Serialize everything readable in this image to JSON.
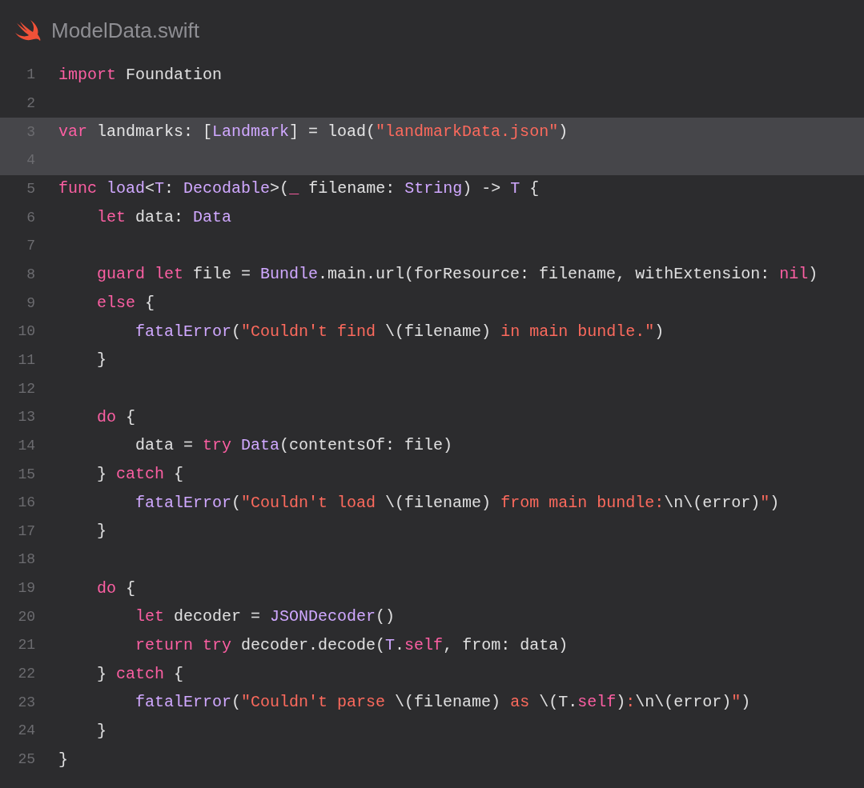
{
  "file_title": "ModelData.swift",
  "lines": [
    {
      "number": "1",
      "highlighted": false,
      "tokens": [
        {
          "kind": "keyword",
          "text": "import"
        },
        {
          "kind": "plain",
          "text": " Foundation"
        }
      ]
    },
    {
      "number": "2",
      "highlighted": false
    },
    {
      "number": "3",
      "highlighted": true,
      "tokens": [
        {
          "kind": "keyword",
          "text": "var"
        },
        {
          "kind": "plain",
          "text": " landmarks: ["
        },
        {
          "kind": "type",
          "text": "Landmark"
        },
        {
          "kind": "plain",
          "text": "] = load("
        },
        {
          "kind": "string",
          "text": "\"landmarkData.json\""
        },
        {
          "kind": "plain",
          "text": ")"
        }
      ]
    },
    {
      "number": "4",
      "highlighted": true
    },
    {
      "number": "5",
      "highlighted": false,
      "tokens": [
        {
          "kind": "keyword",
          "text": "func "
        },
        {
          "kind": "type",
          "text": "load"
        },
        {
          "kind": "plain",
          "text": "<"
        },
        {
          "kind": "type",
          "text": "T"
        },
        {
          "kind": "plain",
          "text": ": "
        },
        {
          "kind": "type",
          "text": "Decodable"
        },
        {
          "kind": "plain",
          "text": ">("
        },
        {
          "kind": "keyword",
          "text": "_"
        },
        {
          "kind": "plain",
          "text": " filename: "
        },
        {
          "kind": "type",
          "text": "String"
        },
        {
          "kind": "plain",
          "text": ") -> "
        },
        {
          "kind": "type",
          "text": "T"
        },
        {
          "kind": "plain",
          "text": " {"
        }
      ]
    },
    {
      "number": "6",
      "highlighted": false,
      "tokens": [
        {
          "kind": "keyword",
          "text": "    let"
        },
        {
          "kind": "plain",
          "text": " data: "
        },
        {
          "kind": "type",
          "text": "Data"
        }
      ]
    },
    {
      "number": "7",
      "highlighted": false
    },
    {
      "number": "8",
      "highlighted": false,
      "tokens": [
        {
          "kind": "keyword",
          "text": "    guard let"
        },
        {
          "kind": "plain",
          "text": " file = "
        },
        {
          "kind": "type",
          "text": "Bundle"
        },
        {
          "kind": "plain",
          "text": ".main.url(forResource: filename, withExtension: "
        },
        {
          "kind": "keyword",
          "text": "nil"
        },
        {
          "kind": "plain",
          "text": ")"
        }
      ]
    },
    {
      "number": "9",
      "highlighted": false,
      "tokens": [
        {
          "kind": "keyword",
          "text": "    else"
        },
        {
          "kind": "plain",
          "text": " {"
        }
      ]
    },
    {
      "number": "10",
      "highlighted": false,
      "tokens": [
        {
          "kind": "type",
          "text": "        fatalError"
        },
        {
          "kind": "plain",
          "text": "("
        },
        {
          "kind": "string",
          "text": "\"Couldn't find "
        },
        {
          "kind": "plain",
          "text": "\\(filename)"
        },
        {
          "kind": "string",
          "text": " in main bundle.\""
        },
        {
          "kind": "plain",
          "text": ")"
        }
      ]
    },
    {
      "number": "11",
      "highlighted": false,
      "tokens": [
        {
          "kind": "plain",
          "text": "    }"
        }
      ]
    },
    {
      "number": "12",
      "highlighted": false
    },
    {
      "number": "13",
      "highlighted": false,
      "tokens": [
        {
          "kind": "keyword",
          "text": "    do"
        },
        {
          "kind": "plain",
          "text": " {"
        }
      ]
    },
    {
      "number": "14",
      "highlighted": false,
      "tokens": [
        {
          "kind": "plain",
          "text": "        data = "
        },
        {
          "kind": "keyword",
          "text": "try "
        },
        {
          "kind": "type",
          "text": "Data"
        },
        {
          "kind": "plain",
          "text": "(contentsOf: file)"
        }
      ]
    },
    {
      "number": "15",
      "highlighted": false,
      "tokens": [
        {
          "kind": "plain",
          "text": "    } "
        },
        {
          "kind": "keyword",
          "text": "catch"
        },
        {
          "kind": "plain",
          "text": " {"
        }
      ]
    },
    {
      "number": "16",
      "highlighted": false,
      "tokens": [
        {
          "kind": "type",
          "text": "        fatalError"
        },
        {
          "kind": "plain",
          "text": "("
        },
        {
          "kind": "string",
          "text": "\"Couldn't load "
        },
        {
          "kind": "plain",
          "text": "\\(filename)"
        },
        {
          "kind": "string",
          "text": " from main bundle:"
        },
        {
          "kind": "plain",
          "text": "\\n\\(error)"
        },
        {
          "kind": "string",
          "text": "\""
        },
        {
          "kind": "plain",
          "text": ")"
        }
      ]
    },
    {
      "number": "17",
      "highlighted": false,
      "tokens": [
        {
          "kind": "plain",
          "text": "    }"
        }
      ]
    },
    {
      "number": "18",
      "highlighted": false
    },
    {
      "number": "19",
      "highlighted": false,
      "tokens": [
        {
          "kind": "keyword",
          "text": "    do"
        },
        {
          "kind": "plain",
          "text": " {"
        }
      ]
    },
    {
      "number": "20",
      "highlighted": false,
      "tokens": [
        {
          "kind": "keyword",
          "text": "        let"
        },
        {
          "kind": "plain",
          "text": " decoder = "
        },
        {
          "kind": "type",
          "text": "JSONDecoder"
        },
        {
          "kind": "plain",
          "text": "()"
        }
      ]
    },
    {
      "number": "21",
      "highlighted": false,
      "tokens": [
        {
          "kind": "keyword",
          "text": "        return try"
        },
        {
          "kind": "plain",
          "text": " decoder.decode("
        },
        {
          "kind": "type",
          "text": "T"
        },
        {
          "kind": "plain",
          "text": "."
        },
        {
          "kind": "keyword",
          "text": "self"
        },
        {
          "kind": "plain",
          "text": ", from: data)"
        }
      ]
    },
    {
      "number": "22",
      "highlighted": false,
      "tokens": [
        {
          "kind": "plain",
          "text": "    } "
        },
        {
          "kind": "keyword",
          "text": "catch"
        },
        {
          "kind": "plain",
          "text": " {"
        }
      ]
    },
    {
      "number": "23",
      "highlighted": false,
      "tokens": [
        {
          "kind": "type",
          "text": "        fatalError"
        },
        {
          "kind": "plain",
          "text": "("
        },
        {
          "kind": "string",
          "text": "\"Couldn't parse "
        },
        {
          "kind": "plain",
          "text": "\\(filename)"
        },
        {
          "kind": "string",
          "text": " as "
        },
        {
          "kind": "plain",
          "text": "\\(T."
        },
        {
          "kind": "keyword",
          "text": "self"
        },
        {
          "kind": "plain",
          "text": ")"
        },
        {
          "kind": "string",
          "text": ":"
        },
        {
          "kind": "plain",
          "text": "\\n\\(error)"
        },
        {
          "kind": "string",
          "text": "\""
        },
        {
          "kind": "plain",
          "text": ")"
        }
      ]
    },
    {
      "number": "24",
      "highlighted": false,
      "tokens": [
        {
          "kind": "plain",
          "text": "    }"
        }
      ]
    },
    {
      "number": "25",
      "highlighted": false,
      "tokens": [
        {
          "kind": "plain",
          "text": "}"
        }
      ]
    }
  ]
}
